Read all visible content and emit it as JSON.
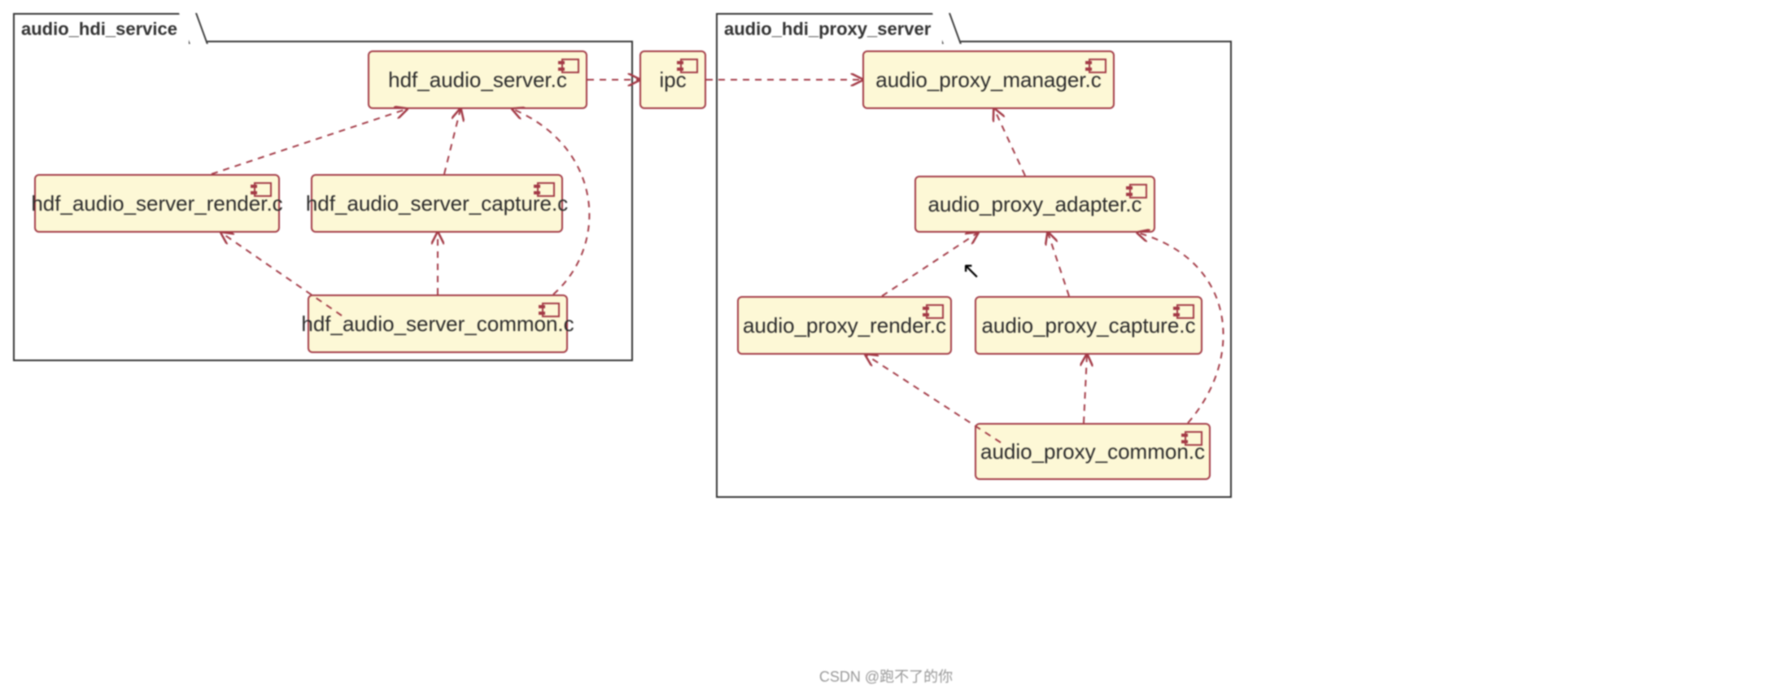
{
  "packages": {
    "left": "audio_hdi_service",
    "right": "audio_hdi_proxy_server"
  },
  "components": {
    "hdf_server": "hdf_audio_server.c",
    "hdf_render": "hdf_audio_server_render.c",
    "hdf_capture": "hdf_audio_server_capture.c",
    "hdf_common": "hdf_audio_server_common.c",
    "ipc": "ipc",
    "proxy_manager": "audio_proxy_manager.c",
    "proxy_adapter": "audio_proxy_adapter.c",
    "proxy_render": "audio_proxy_render.c",
    "proxy_capture": "audio_proxy_capture.c",
    "proxy_common": "audio_proxy_common.c"
  },
  "arrow_color": "#a33a46",
  "watermark": "CSDN @跑不了的你"
}
